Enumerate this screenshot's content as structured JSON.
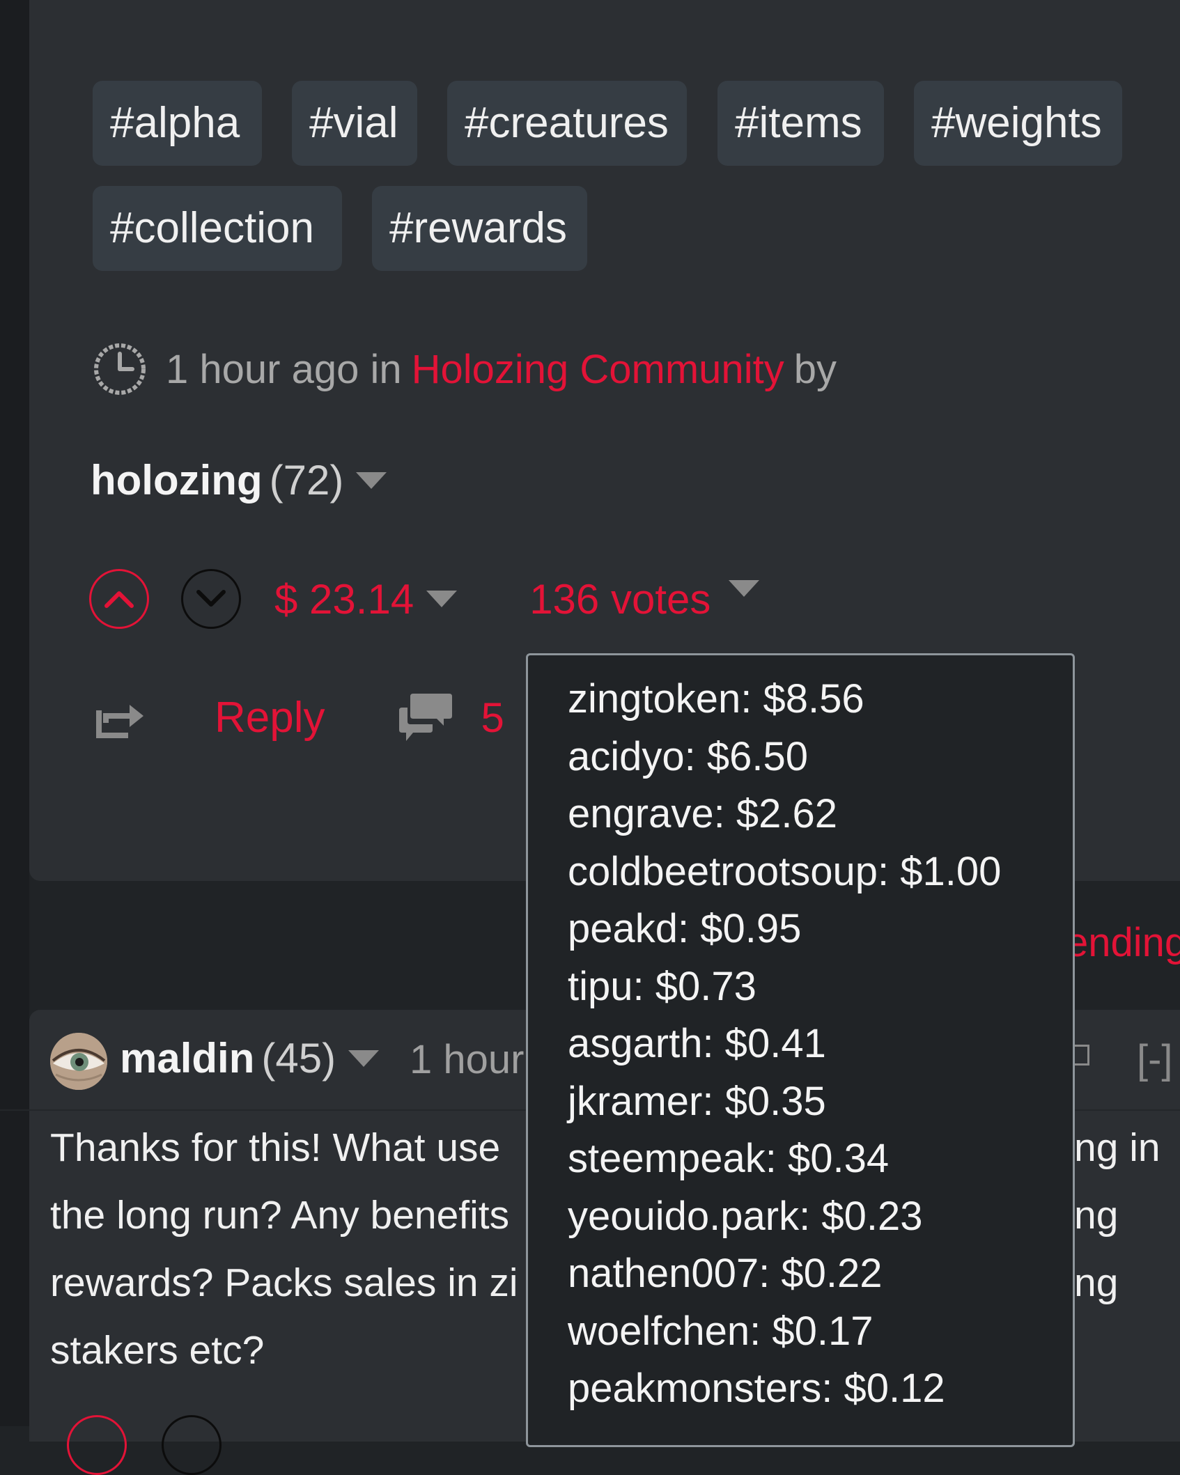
{
  "tags": [
    "#alpha",
    "#vial",
    "#creatures",
    "#items",
    "#weights",
    "#collection",
    "#rewards"
  ],
  "post_meta": {
    "time": "1 hour ago in",
    "community": "Holozing Community",
    "by": "by"
  },
  "author": {
    "name": "holozing",
    "reputation": "(72)"
  },
  "voting": {
    "payout": "$ 23.14",
    "votes": "136 votes"
  },
  "actions": {
    "reply": "Reply",
    "comment_count": "5"
  },
  "sort": {
    "label": "ending"
  },
  "comment": {
    "author": "maldin",
    "reputation": "(45)",
    "time": "1 hour",
    "collapse": "[-]",
    "body_lines": [
      {
        "left": "Thanks for this! What use",
        "right": "ng in"
      },
      {
        "left": "the long run? Any benefits",
        "right": "ng"
      },
      {
        "left": "rewards? Packs sales in zi",
        "right": "ng"
      },
      {
        "left": "stakers etc?",
        "right": ""
      }
    ]
  },
  "voters_tooltip": [
    "zingtoken: $8.56",
    "acidyo: $6.50",
    "engrave: $2.62",
    "coldbeetrootsoup: $1.00",
    "peakd: $0.95",
    "tipu: $0.73",
    "asgarth: $0.41",
    "jkramer: $0.35",
    "steempeak: $0.34",
    "yeouido.park: $0.23",
    "nathen007: $0.22",
    "woelfchen: $0.17",
    "peakmonsters: $0.12"
  ],
  "colors": {
    "accent": "#e31337",
    "background": "#202326",
    "card": "#2c2f33",
    "tag": "#363d44"
  },
  "icons": [
    "clock-icon",
    "upvote-icon",
    "downvote-icon",
    "caret-down-icon",
    "reblog-icon",
    "comments-icon"
  ]
}
